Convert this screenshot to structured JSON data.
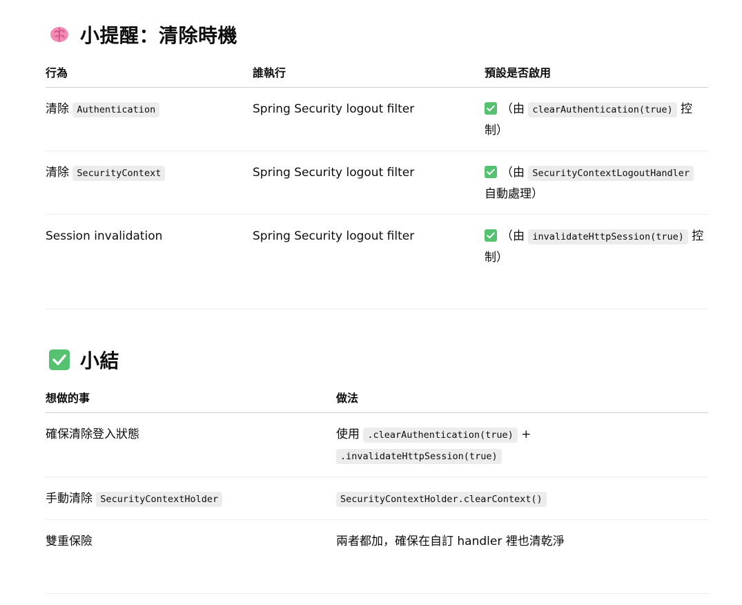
{
  "section1": {
    "title": "小提醒：清除時機",
    "icon": "brain-icon",
    "columns": [
      "行為",
      "誰執行",
      "預設是否啟用"
    ],
    "rows": [
      {
        "action_prefix": "清除",
        "action_code": "Authentication",
        "executor": "Spring Security logout filter",
        "default_prefix": "（由",
        "default_code": "clearAuthentication(true)",
        "default_suffix": "控制）"
      },
      {
        "action_prefix": "清除",
        "action_code": "SecurityContext",
        "executor": "Spring Security logout filter",
        "default_prefix": "（由",
        "default_code": "SecurityContextLogoutHandler",
        "default_suffix": "自動處理）"
      },
      {
        "action_text": "Session invalidation",
        "executor": "Spring Security logout filter",
        "default_prefix": "（由",
        "default_code": "invalidateHttpSession(true)",
        "default_suffix": "控制）"
      }
    ]
  },
  "section2": {
    "title": "小結",
    "icon": "check-mark-icon",
    "columns": [
      "想做的事",
      "做法"
    ],
    "rows": [
      {
        "goal": "確保清除登入狀態",
        "method_prefix": "使用",
        "method_code1": ".clearAuthentication(true)",
        "method_plus": "+",
        "method_code2": ".invalidateHttpSession(true)"
      },
      {
        "goal_prefix": "手動清除",
        "goal_code": "SecurityContextHolder",
        "method_code": "SecurityContextHolder.clearContext()"
      },
      {
        "goal": "雙重保險",
        "method_text": "兩者都加，確保在自訂 handler 裡也清乾淨"
      }
    ]
  },
  "colors": {
    "check_green": "#56c271",
    "code_bg": "#ececec",
    "brain_pink": "#f28bb3"
  }
}
